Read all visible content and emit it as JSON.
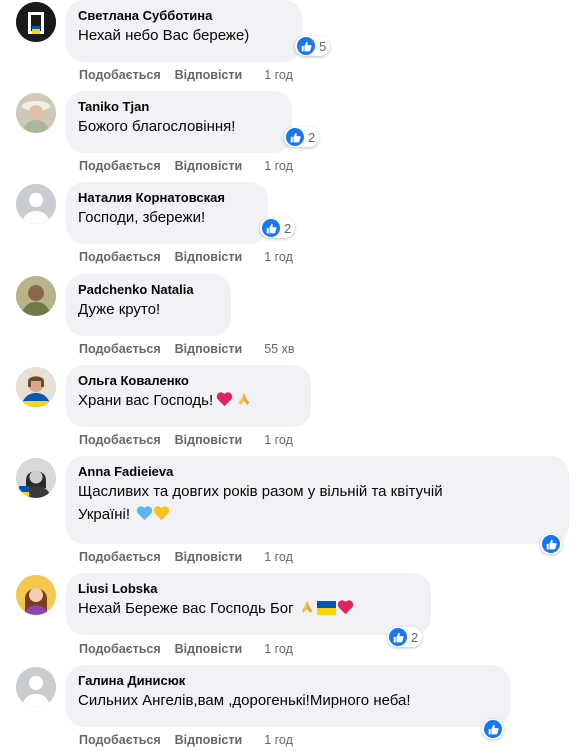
{
  "labels": {
    "like": "Подобається",
    "reply": "Відповісти"
  },
  "colors": {
    "bubble": "#f0f2f5",
    "like": "#1877f2",
    "meta": "#65676b"
  },
  "comments": [
    {
      "author": "Светлана Субботина",
      "text": "Нехай небо Вас береже)",
      "reactions": "5",
      "time": "1 год"
    },
    {
      "author": "Taniko Tjan",
      "text": "Божого благословіння!",
      "reactions": "2",
      "time": "1 год"
    },
    {
      "author": "Наталия Корнатовская",
      "text": "Господи, збережи!",
      "reactions": "2",
      "time": "1 год"
    },
    {
      "author": "Padchenko Natalia",
      "text": "Дуже круто!",
      "reactions": "",
      "time": "55 хв"
    },
    {
      "author": "Ольга Коваленко",
      "text": "Храни вас Господь!",
      "reactions": "",
      "time": "1 год"
    },
    {
      "author": "Anna Fadieieva",
      "text_line1": "Щасливих та довгих років разом у вільній та квітучій",
      "text_line2": "Україні!",
      "reactions": "",
      "time": "1 год"
    },
    {
      "author": "Liusi Lobska",
      "text": "Нехай Береже вас Господь Бог",
      "reactions": "2",
      "time": "1 год"
    },
    {
      "author": "Галина Динисюк",
      "text": "Сильних Ангелів,вам ,дорогенькі!Мирного неба!",
      "reactions": "",
      "time": "1 год"
    }
  ],
  "icons": {
    "like": "like-thumb-icon",
    "heart": "red-heart-emoji",
    "pray": "folded-hands-emoji",
    "blue_heart": "blue-heart-emoji",
    "yellow_heart": "yellow-heart-emoji",
    "flag": "ukraine-flag-emoji"
  }
}
